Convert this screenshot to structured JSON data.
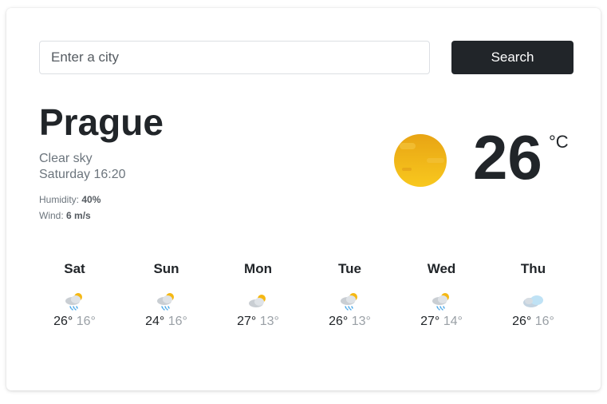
{
  "search": {
    "placeholder": "Enter a city",
    "value": "",
    "button_label": "Search"
  },
  "current": {
    "city": "Prague",
    "description": "Clear sky",
    "datetime": "Saturday 16:20",
    "humidity_label": "Humidity:",
    "humidity_value": "40%",
    "wind_label": "Wind:",
    "wind_value": "6 m/s",
    "temperature": "26",
    "unit": "°C",
    "icon": "sun-icon"
  },
  "forecast": [
    {
      "day": "Sat",
      "max": "26°",
      "min": "16°",
      "icon": "partly-cloudy-rain-icon"
    },
    {
      "day": "Sun",
      "max": "24°",
      "min": "16°",
      "icon": "partly-cloudy-rain-icon"
    },
    {
      "day": "Mon",
      "max": "27°",
      "min": "13°",
      "icon": "partly-cloudy-icon"
    },
    {
      "day": "Tue",
      "max": "26°",
      "min": "13°",
      "icon": "partly-cloudy-rain-icon"
    },
    {
      "day": "Wed",
      "max": "27°",
      "min": "14°",
      "icon": "partly-cloudy-rain-icon"
    },
    {
      "day": "Thu",
      "max": "26°",
      "min": "16°",
      "icon": "cloud-icon"
    }
  ],
  "colors": {
    "button_bg": "#212529",
    "text_dark": "#212529",
    "text_muted": "#6c757d",
    "min_temp": "#9aa0a6",
    "sun": "#f5b814"
  }
}
